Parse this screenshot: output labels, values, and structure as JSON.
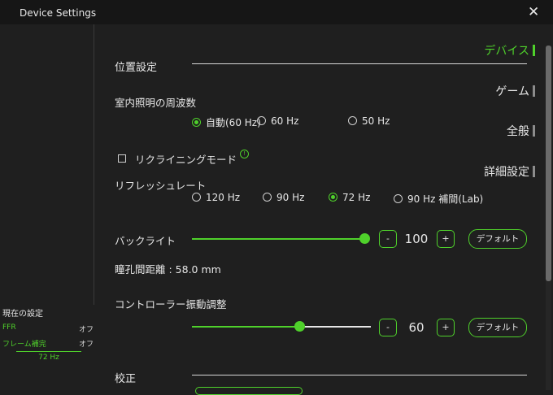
{
  "window": {
    "title": "Device Settings",
    "close_glyph": "✕"
  },
  "sidebar": {
    "items": [
      {
        "label": "デバイス",
        "active": true
      },
      {
        "label": "ゲーム",
        "active": false
      },
      {
        "label": "全般",
        "active": false
      },
      {
        "label": "詳細設定",
        "active": false
      }
    ]
  },
  "current_settings": {
    "title": "現在の設定",
    "rows": [
      {
        "key": "FFR",
        "value": "オフ"
      },
      {
        "key": "フレーム補完",
        "value": "オフ"
      }
    ],
    "refresh": "72 Hz"
  },
  "position": {
    "section_title": "位置設定",
    "flicker": {
      "label": "室内照明の周波数",
      "options": [
        "自動(60 Hz)",
        "60 Hz",
        "50 Hz"
      ],
      "selected": 0
    },
    "recline": {
      "label": "リクライニングモード",
      "checked": false,
      "info_glyph": "!"
    },
    "refresh_rate": {
      "label": "リフレッシュレート",
      "options": [
        "120 Hz",
        "90 Hz",
        "72 Hz",
        "90 Hz 補間(Lab)"
      ],
      "selected": 2
    },
    "backlight": {
      "label": "バックライト",
      "value": "100",
      "level": 1.0,
      "minus": "-",
      "plus": "+",
      "default_label": "デフォルト"
    },
    "ipd": {
      "text": "瞳孔間距離 : 58.0 mm"
    },
    "vibration": {
      "label": "コントローラー振動調整",
      "value": "60",
      "level": 0.6,
      "minus": "-",
      "plus": "+",
      "default_label": "デフォルト"
    }
  },
  "calibration": {
    "section_title": "校正"
  },
  "colors": {
    "accent": "#4fd12b",
    "background": "#1f1f1f",
    "titlebar": "#161616"
  }
}
